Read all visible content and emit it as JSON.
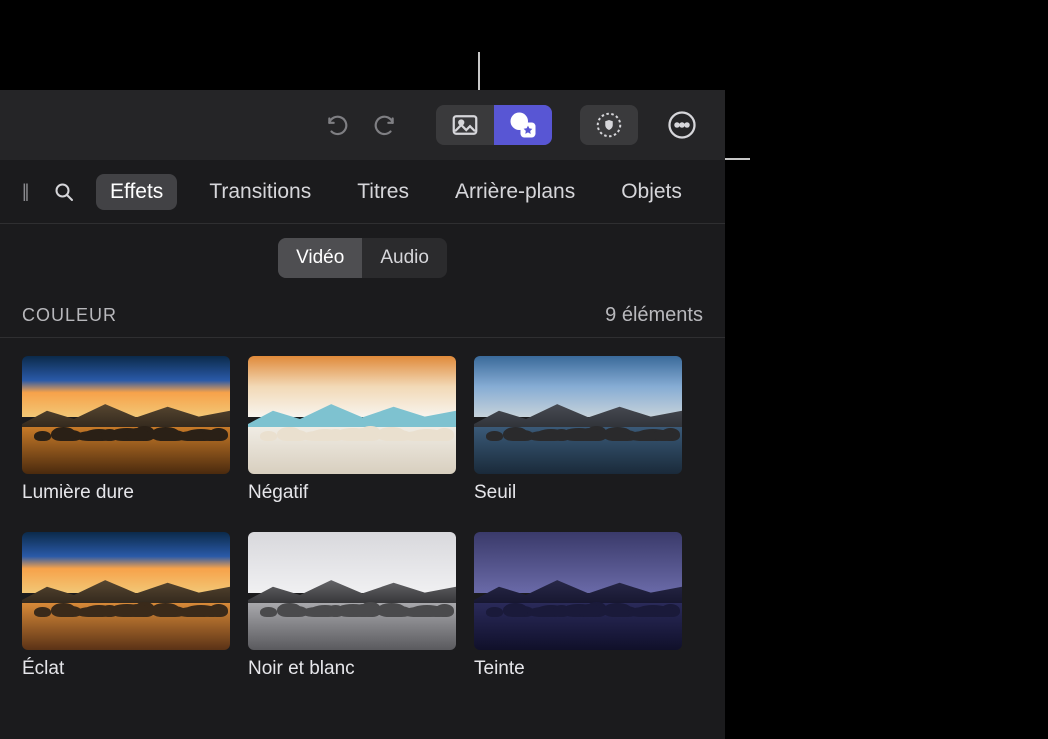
{
  "toolbar": {
    "undo_icon": "undo-icon",
    "redo_icon": "redo-icon",
    "media_icon": "image-icon",
    "effects_icon": "star-badge-icon",
    "mask_icon": "dotted-shield-icon",
    "more_icon": "ellipsis-circle-icon"
  },
  "tabs": {
    "items": [
      {
        "id": "effects",
        "label": "Effets",
        "active": true
      },
      {
        "id": "transitions",
        "label": "Transitions",
        "active": false
      },
      {
        "id": "titles",
        "label": "Titres",
        "active": false
      },
      {
        "id": "backgrounds",
        "label": "Arrière-plans",
        "active": false
      },
      {
        "id": "objects",
        "label": "Objets",
        "active": false
      }
    ]
  },
  "subtabs": {
    "video": "Vidéo",
    "audio": "Audio",
    "active": "video"
  },
  "section": {
    "title": "COULEUR",
    "count_label": "9 éléments"
  },
  "effects": [
    {
      "id": "hard-light",
      "label": "Lumière dure",
      "variant": "hard"
    },
    {
      "id": "negative",
      "label": "Négatif",
      "variant": "neg"
    },
    {
      "id": "threshold",
      "label": "Seuil",
      "variant": "seul"
    },
    {
      "id": "glow",
      "label": "Éclat",
      "variant": "eclat"
    },
    {
      "id": "bw",
      "label": "Noir et blanc",
      "variant": "bw"
    },
    {
      "id": "tint",
      "label": "Teinte",
      "variant": "tint"
    }
  ]
}
